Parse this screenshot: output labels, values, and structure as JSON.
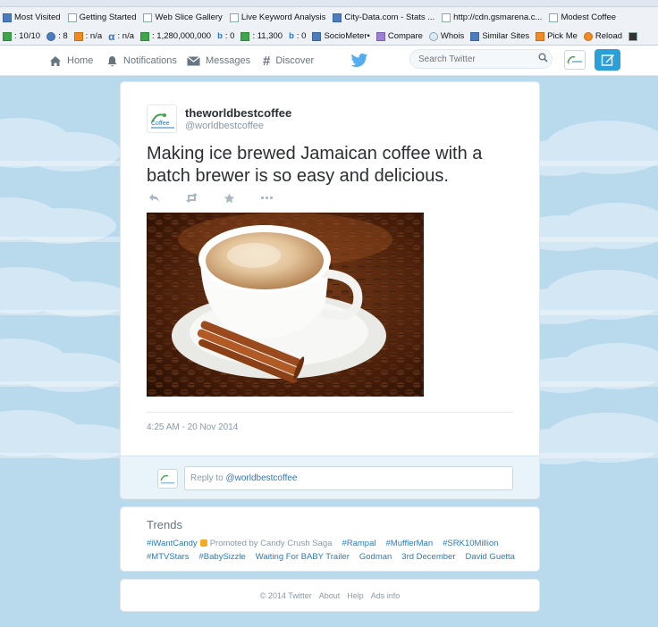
{
  "browser": {
    "bookmarks": [
      {
        "label": "Most Visited",
        "icon": "bookmark-icon"
      },
      {
        "label": "Getting Started",
        "icon": "page-icon"
      },
      {
        "label": "Web Slice Gallery",
        "icon": "page-icon"
      },
      {
        "label": "Live Keyword Analysis",
        "icon": "page-icon"
      },
      {
        "label": "City-Data.com - Stats ...",
        "icon": "site-icon"
      },
      {
        "label": "http://cdn.gsmarena.c...",
        "icon": "page-icon"
      },
      {
        "label": "Modest Coffee",
        "icon": "page-icon"
      }
    ],
    "addon_bar": [
      {
        "label": ": 10/10",
        "icon": "google-pr-icon"
      },
      {
        "label": ": 8",
        "icon": "info-icon"
      },
      {
        "label": ": n/a",
        "icon": "stats-icon"
      },
      {
        "label": ": n/a",
        "icon": "alexa-icon"
      },
      {
        "label": ": 1,280,000,000",
        "icon": "google-index-icon"
      },
      {
        "label": ": 0",
        "icon": "bing-icon"
      },
      {
        "label": ": 11,300",
        "icon": "google-links-icon"
      },
      {
        "label": ": 0",
        "icon": "bing-links-icon"
      },
      {
        "label": "SocioMeter•",
        "icon": "sociometer-icon"
      },
      {
        "label": "Compare",
        "icon": "compare-icon"
      },
      {
        "label": "Whois",
        "icon": "whois-icon"
      },
      {
        "label": "Similar Sites",
        "icon": "similar-sites-icon"
      },
      {
        "label": "Pick Me",
        "icon": "pick-me-icon"
      },
      {
        "label": "Reload",
        "icon": "reload-icon"
      },
      {
        "label": "",
        "icon": "more-icon"
      }
    ]
  },
  "nav": {
    "home": "Home",
    "notifications": "Notifications",
    "messages": "Messages",
    "discover": "Discover",
    "search_placeholder": "Search Twitter"
  },
  "tweet": {
    "fullname": "theworldbestcoffee",
    "handle": "@worldbestcoffee",
    "text": "Making ice brewed Jamaican coffee with a batch brewer is so easy and delicious.",
    "timestamp": "4:25 AM - 20 Nov 2014",
    "reply_prefix": "Reply to ",
    "reply_handle": "@worldbestcoffee"
  },
  "trends": {
    "title": "Trends",
    "row1": [
      {
        "label": "#iWantCandy",
        "promoted_by": "Promoted by Candy Crush Saga"
      },
      {
        "label": "#Rampal"
      },
      {
        "label": "#MufflerMan"
      },
      {
        "label": "#SRK10Million"
      }
    ],
    "row2": [
      {
        "label": "#MTVStars"
      },
      {
        "label": "#BabySizzle"
      },
      {
        "label": "Waiting For BABY Trailer"
      },
      {
        "label": "Godman"
      },
      {
        "label": "3rd December"
      },
      {
        "label": "David Guetta"
      }
    ]
  },
  "footer": {
    "copyright": "© 2014 Twitter",
    "links": [
      "About",
      "Help",
      "Ads info"
    ]
  },
  "colors": {
    "twitter_blue": "#55acee",
    "link_blue": "#2b7bb9",
    "compose_blue": "#2b9fd8",
    "sky_background": "#b9d9ec"
  }
}
